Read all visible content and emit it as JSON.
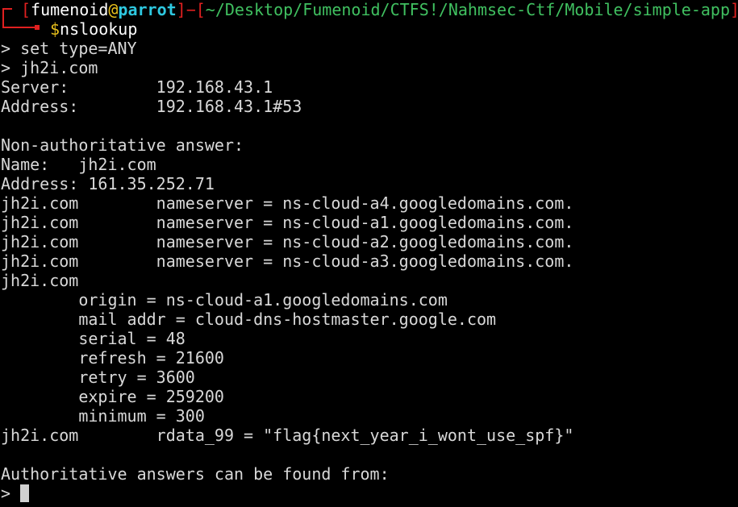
{
  "prompt": {
    "user": "fumenoid",
    "at": "@",
    "host": "parrot",
    "path": "~/Desktop/Fumenoid/CTFS!/Nahmsec-Ctf/Mobile/simple-app",
    "dollar": "$",
    "command": "nslookup"
  },
  "output_lines": [
    "> set type=ANY",
    "> jh2i.com",
    "Server:         192.168.43.1",
    "Address:        192.168.43.1#53",
    "",
    "Non-authoritative answer:",
    "Name:   jh2i.com",
    "Address: 161.35.252.71",
    "jh2i.com        nameserver = ns-cloud-a4.googledomains.com.",
    "jh2i.com        nameserver = ns-cloud-a1.googledomains.com.",
    "jh2i.com        nameserver = ns-cloud-a2.googledomains.com.",
    "jh2i.com        nameserver = ns-cloud-a3.googledomains.com.",
    "jh2i.com",
    "        origin = ns-cloud-a1.googledomains.com",
    "        mail addr = cloud-dns-hostmaster.google.com",
    "        serial = 48",
    "        refresh = 21600",
    "        retry = 3600",
    "        expire = 259200",
    "        minimum = 300",
    "jh2i.com        rdata_99 = \"flag{next_year_i_wont_use_spf}\"",
    "",
    "Authoritative answers can be found from:"
  ],
  "input_prompt": "> ",
  "colors": {
    "background": "#000000",
    "text": "#d8d8d8",
    "bracket": "#e02020",
    "host": "#2ec8e0",
    "at": "#e8c01c",
    "path": "#40c060",
    "dollar": "#e8c01c"
  }
}
